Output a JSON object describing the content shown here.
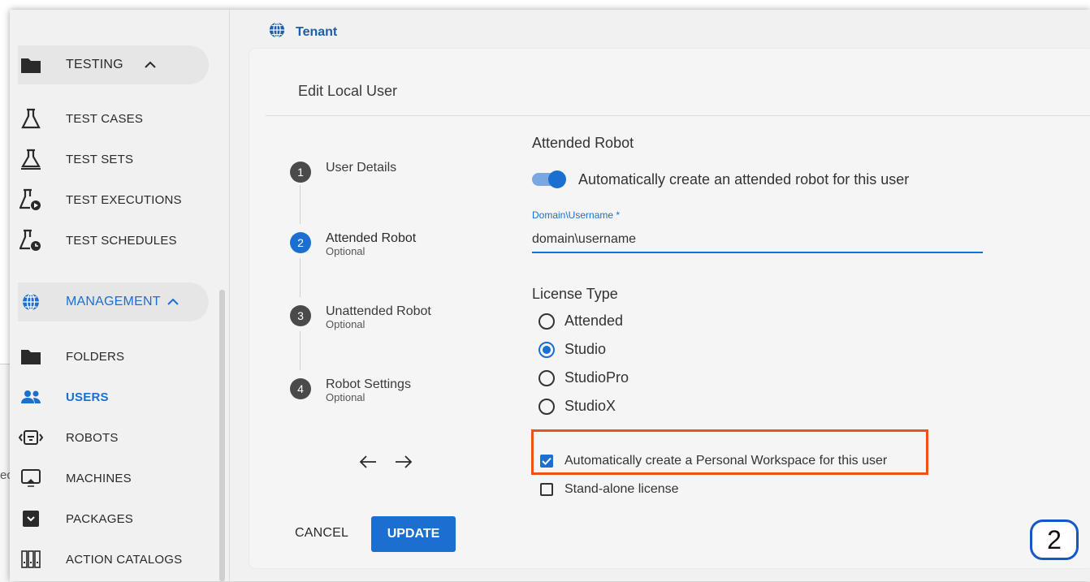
{
  "sidebar": {
    "testing_group": {
      "label": "TESTING"
    },
    "testing_items": [
      {
        "label": "TEST CASES"
      },
      {
        "label": "TEST SETS"
      },
      {
        "label": "TEST EXECUTIONS"
      },
      {
        "label": "TEST SCHEDULES"
      }
    ],
    "management_group": {
      "label": "MANAGEMENT"
    },
    "management_items": [
      {
        "label": "FOLDERS",
        "active": false
      },
      {
        "label": "USERS",
        "active": true
      },
      {
        "label": "ROBOTS",
        "active": false
      },
      {
        "label": "MACHINES",
        "active": false
      },
      {
        "label": "PACKAGES",
        "active": false
      },
      {
        "label": "ACTION CATALOGS",
        "active": false
      }
    ]
  },
  "header": {
    "tenant_label": "Tenant"
  },
  "dialog": {
    "title": "Edit Local User",
    "steps": [
      {
        "num": "1",
        "title": "User Details",
        "subtitle": ""
      },
      {
        "num": "2",
        "title": "Attended Robot",
        "subtitle": "Optional"
      },
      {
        "num": "3",
        "title": "Unattended Robot",
        "subtitle": "Optional"
      },
      {
        "num": "4",
        "title": "Robot Settings",
        "subtitle": "Optional"
      }
    ],
    "cancel_label": "CANCEL",
    "update_label": "UPDATE",
    "attended_robot": {
      "section_title": "Attended Robot",
      "toggle_label": "Automatically create an attended robot for this user",
      "toggle_on": true,
      "username_label": "Domain\\Username *",
      "username_value": "domain\\username"
    },
    "license": {
      "section_title": "License Type",
      "options": [
        "Attended",
        "Studio",
        "StudioPro",
        "StudioX"
      ],
      "selected": "Studio"
    },
    "checkboxes": [
      {
        "label": "Automatically create a Personal Workspace for this user",
        "checked": true
      },
      {
        "label": "Stand-alone license",
        "checked": false
      }
    ]
  },
  "annotation": {
    "step_badge": "2",
    "highlight_color": "#f14f1b"
  },
  "peek_text": "ec",
  "colors": {
    "accent": "#1a6fd1",
    "highlight": "#f14f1b"
  }
}
